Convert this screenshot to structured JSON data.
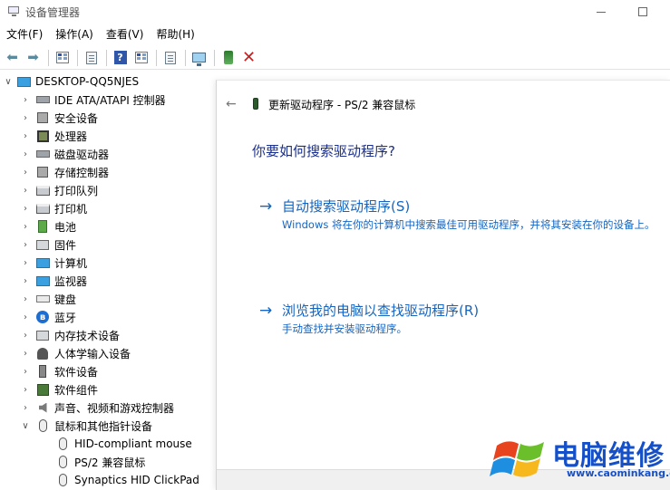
{
  "window": {
    "title": "设备管理器"
  },
  "menu": [
    {
      "label": "文件(F)"
    },
    {
      "label": "操作(A)"
    },
    {
      "label": "查看(V)"
    },
    {
      "label": "帮助(H)"
    }
  ],
  "tree": {
    "root": "DESKTOP-QQ5NJES",
    "categories": [
      {
        "label": "IDE ATA/ATAPI 控制器",
        "icon": "ide-controller-icon"
      },
      {
        "label": "安全设备",
        "icon": "security-device-icon"
      },
      {
        "label": "处理器",
        "icon": "processor-icon"
      },
      {
        "label": "磁盘驱动器",
        "icon": "disk-drive-icon"
      },
      {
        "label": "存储控制器",
        "icon": "storage-controller-icon"
      },
      {
        "label": "打印队列",
        "icon": "print-queue-icon"
      },
      {
        "label": "打印机",
        "icon": "printer-icon"
      },
      {
        "label": "电池",
        "icon": "battery-icon"
      },
      {
        "label": "固件",
        "icon": "firmware-icon"
      },
      {
        "label": "计算机",
        "icon": "computer-icon"
      },
      {
        "label": "监视器",
        "icon": "monitor-icon"
      },
      {
        "label": "键盘",
        "icon": "keyboard-icon"
      },
      {
        "label": "蓝牙",
        "icon": "bluetooth-icon"
      },
      {
        "label": "内存技术设备",
        "icon": "memory-device-icon"
      },
      {
        "label": "人体学输入设备",
        "icon": "hid-icon"
      },
      {
        "label": "软件设备",
        "icon": "software-device-icon"
      },
      {
        "label": "软件组件",
        "icon": "software-component-icon"
      },
      {
        "label": "声音、视频和游戏控制器",
        "icon": "sound-icon"
      },
      {
        "label": "鼠标和其他指针设备",
        "icon": "mouse-icon"
      }
    ],
    "mouse_children": [
      {
        "label": "HID-compliant mouse"
      },
      {
        "label": "PS/2 兼容鼠标"
      },
      {
        "label": "Synaptics HID ClickPad"
      }
    ]
  },
  "wizard": {
    "header": "更新驱动程序 - PS/2 兼容鼠标",
    "question": "你要如何搜索驱动程序?",
    "option_auto": {
      "title": "自动搜索驱动程序(S)",
      "desc": "Windows 将在你的计算机中搜索最佳可用驱动程序，并将其安装在你的设备上。"
    },
    "option_browse": {
      "title": "浏览我的电脑以查找驱动程序(R)",
      "desc": "手动查找并安装驱动程序。"
    }
  },
  "watermark": {
    "title": "电脑维修",
    "url": "www.caominkang.com"
  },
  "colors": {
    "link_blue": "#1565c0",
    "question_blue": "#1a2f8c",
    "watermark_blue": "#1550c8"
  }
}
